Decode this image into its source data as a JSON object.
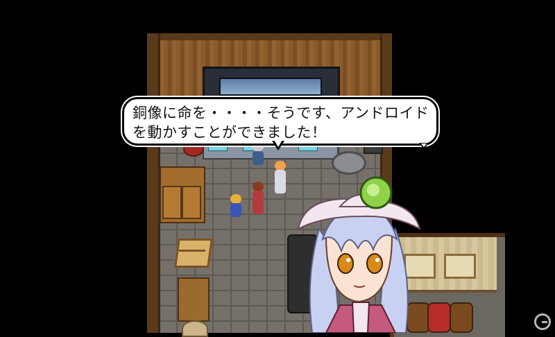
{
  "dialogue": {
    "line1": "銅像に命を・・・・そうです、アンドロイド",
    "line2": "を動かすことができました！",
    "advance_icon": "triangle-down-icon"
  },
  "scene": {
    "setting": "interior-workshop",
    "characters": [
      {
        "role": "scientist",
        "hair": "#c9c9c9",
        "outfit": "#3e5f8a"
      },
      {
        "role": "android-girl",
        "hair": "#f2a24a",
        "outfit": "#c95a77"
      },
      {
        "role": "blonde-companion",
        "hair": "#e8b23a",
        "outfit": "#3a55b5"
      },
      {
        "role": "hero",
        "hair": "#8b3b1e",
        "outfit": "#b23c3c"
      }
    ]
  },
  "portrait": {
    "hair_color": "#c9d1f2",
    "eye_color": "#d88a1a",
    "hat_color": "#f3e7ef",
    "gem_color": "#8fd24a"
  },
  "watermark_icon": "g-logo-icon"
}
